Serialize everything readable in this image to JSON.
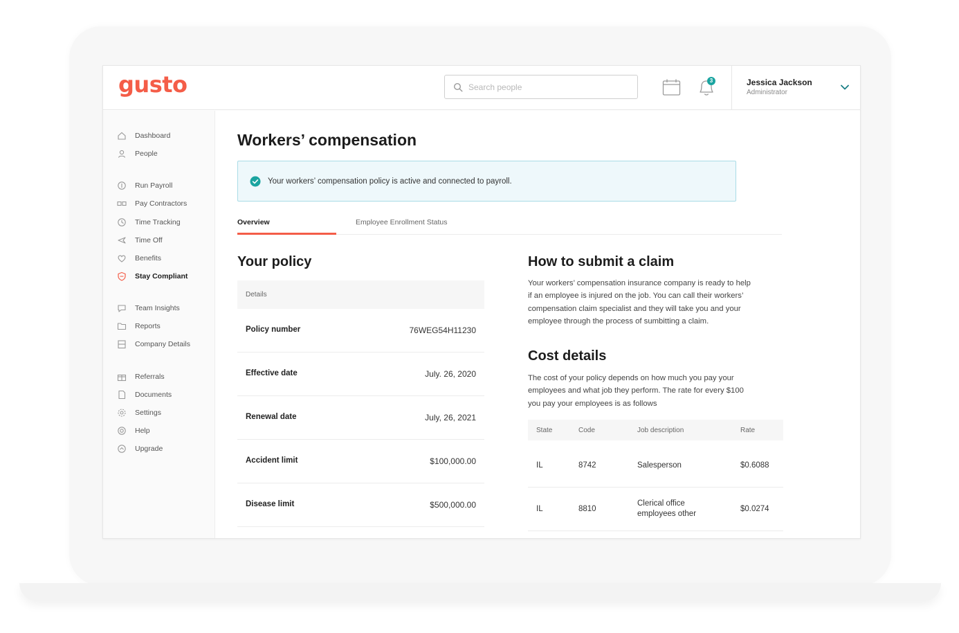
{
  "app": {
    "logo_text": "gusto",
    "brand_color": "#f45d48",
    "accent_color": "#1aa4a0"
  },
  "header": {
    "search_placeholder": "Search people",
    "notifications_count": "3",
    "user_name": "Jessica Jackson",
    "user_role": "Administrator",
    "icons": [
      "search-icon",
      "calendar-icon",
      "bell-icon",
      "chevron-down-icon"
    ]
  },
  "sidebar": {
    "items": [
      {
        "label": "Dashboard",
        "icon": "home-icon"
      },
      {
        "label": "People",
        "icon": "person-icon"
      },
      {
        "label": "Run Payroll",
        "icon": "payroll-icon"
      },
      {
        "label": "Pay Contractors",
        "icon": "contractors-icon"
      },
      {
        "label": "Time Tracking",
        "icon": "clock-icon"
      },
      {
        "label": "Time Off",
        "icon": "plane-icon"
      },
      {
        "label": "Benefits",
        "icon": "heart-icon"
      },
      {
        "label": "Stay Compliant",
        "icon": "shield-icon"
      },
      {
        "label": "Team Insights",
        "icon": "chat-icon"
      },
      {
        "label": "Reports",
        "icon": "folder-icon"
      },
      {
        "label": "Company Details",
        "icon": "building-icon"
      },
      {
        "label": "Referrals",
        "icon": "gift-icon"
      },
      {
        "label": "Documents",
        "icon": "document-icon"
      },
      {
        "label": "Settings",
        "icon": "gear-icon"
      },
      {
        "label": "Help",
        "icon": "help-icon"
      },
      {
        "label": "Upgrade",
        "icon": "upgrade-icon"
      }
    ],
    "active": "Stay Compliant"
  },
  "main": {
    "title": "Workers’ compensation",
    "alert": "Your workers’ compensation policy is active and connected to payroll.",
    "tabs": [
      {
        "label": "Overview",
        "active": true
      },
      {
        "label": "Employee Enrollment Status",
        "active": false
      }
    ],
    "policy": {
      "title": "Your policy",
      "details_header": "Details",
      "rows": [
        {
          "label": "Policy number",
          "value": "76WEG54H11230"
        },
        {
          "label": "Effective date",
          "value": "July. 26, 2020"
        },
        {
          "label": "Renewal date",
          "value": "July, 26, 2021"
        },
        {
          "label": "Accident limit",
          "value": "$100,000.00"
        },
        {
          "label": "Disease limit",
          "value": "$500,000.00"
        }
      ]
    },
    "claim": {
      "title": "How to submit a claim",
      "lines": [
        "Your workers’ compensation insurance company is ready to help",
        "if an employee is injured on the job. You can call their workers’",
        "compensation claim specialist and they will take you and your",
        "employee through the process of sumbitting a claim."
      ]
    },
    "cost": {
      "title": "Cost details",
      "lines": [
        "The cost of your policy depends on how much you pay your",
        "employees and what job they perform. The rate for every $100",
        "you pay your employees is as follows"
      ],
      "columns": [
        "State",
        "Code",
        "Job description",
        "Rate"
      ],
      "rows": [
        {
          "state": "IL",
          "code": "8742",
          "job": "Salesperson",
          "rate": "$0.6088"
        },
        {
          "state": "IL",
          "code": "8810",
          "job": "Clerical office employees other",
          "rate": "$0.0274"
        }
      ]
    }
  }
}
